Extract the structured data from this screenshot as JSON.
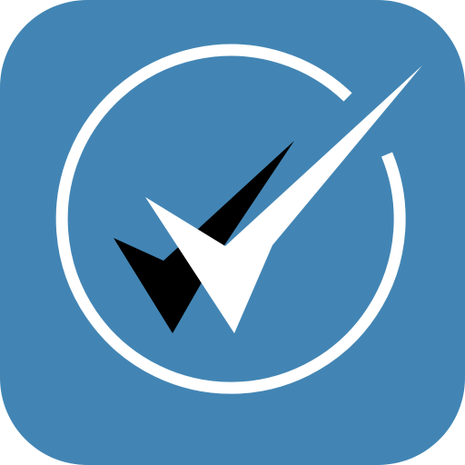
{
  "icon": {
    "name": "double-checkmark-app-icon",
    "background_color": "#4285B4",
    "ring_color": "#FFFFFF",
    "front_check_color": "#FFFFFF",
    "back_check_color": "#000000"
  }
}
